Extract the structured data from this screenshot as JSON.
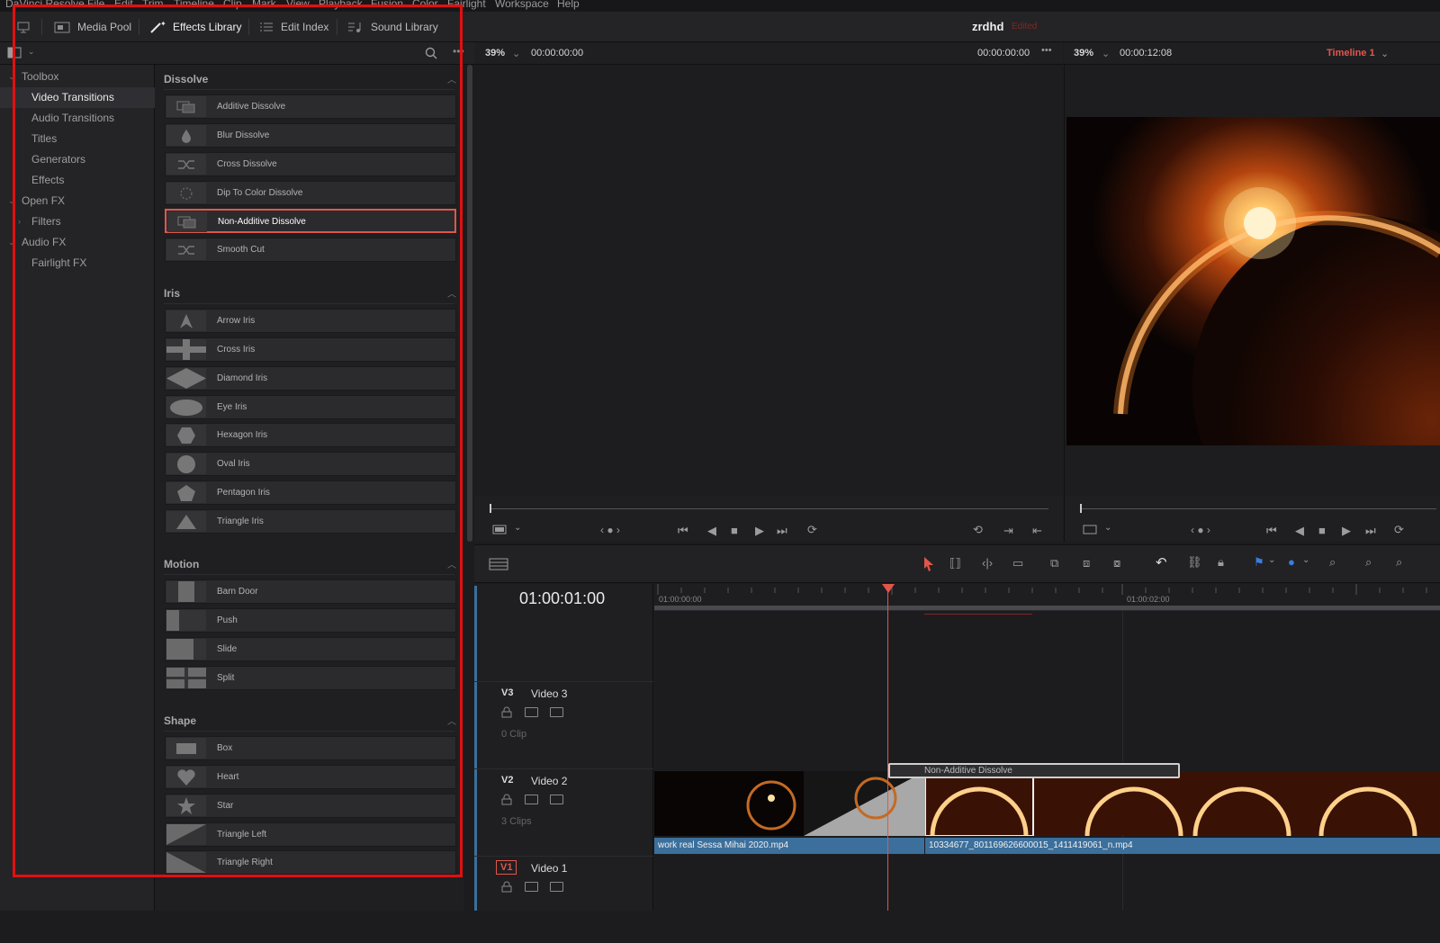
{
  "menu": [
    "DaVinci Resolve",
    "File",
    "Edit",
    "Trim",
    "Timeline",
    "Clip",
    "Mark",
    "View",
    "Playback",
    "Fusion",
    "Color",
    "Fairlight",
    "Workspace",
    "Help"
  ],
  "toolbar": {
    "media_pool": "Media Pool",
    "effects_library": "Effects Library",
    "edit_index": "Edit Index",
    "sound_library": "Sound Library",
    "project_name": "zrdhd",
    "project_status": "Edited"
  },
  "tree": {
    "toolbox": "Toolbox",
    "video_transitions": "Video Transitions",
    "audio_transitions": "Audio Transitions",
    "titles": "Titles",
    "generators": "Generators",
    "effects": "Effects",
    "open_fx": "Open FX",
    "filters": "Filters",
    "audio_fx": "Audio FX",
    "fairlight_fx": "Fairlight FX"
  },
  "sections": {
    "dissolve": {
      "title": "Dissolve",
      "items": [
        "Additive Dissolve",
        "Blur Dissolve",
        "Cross Dissolve",
        "Dip To Color Dissolve",
        "Non-Additive Dissolve",
        "Smooth Cut"
      ]
    },
    "iris": {
      "title": "Iris",
      "items": [
        "Arrow Iris",
        "Cross Iris",
        "Diamond Iris",
        "Eye Iris",
        "Hexagon Iris",
        "Oval Iris",
        "Pentagon Iris",
        "Triangle Iris"
      ]
    },
    "motion": {
      "title": "Motion",
      "items": [
        "Barn Door",
        "Push",
        "Slide",
        "Split"
      ]
    },
    "shape": {
      "title": "Shape",
      "items": [
        "Box",
        "Heart",
        "Star",
        "Triangle Left",
        "Triangle Right"
      ]
    }
  },
  "source_viewer": {
    "zoom": "39%",
    "timecode_left": "00:00:00:00",
    "timecode_right": "00:00:00:00"
  },
  "timeline_viewer": {
    "zoom": "39%",
    "timecode": "00:00:12:08",
    "timeline_name": "Timeline 1"
  },
  "timeline": {
    "current_timecode": "01:00:01:00",
    "ruler_start": "01:00:00:00",
    "ruler_mark": "01:00:02:00",
    "transition_label": "Non-Additive Dissolve",
    "tracks": [
      {
        "id": "V3",
        "name": "Video 3",
        "count": "0 Clip"
      },
      {
        "id": "V2",
        "name": "Video 2",
        "count": "3 Clips"
      },
      {
        "id": "V1",
        "name": "Video 1",
        "count": ""
      }
    ],
    "clips": [
      "work real Sessa Mihai 2020.mp4",
      "10334677_801169626600015_1411419061_n.mp4"
    ]
  },
  "colors": {
    "accent_red": "#e0574a",
    "annotation_red": "#e01010",
    "clip_blue": "#3c6f9b",
    "playhead": "#e0574a"
  }
}
